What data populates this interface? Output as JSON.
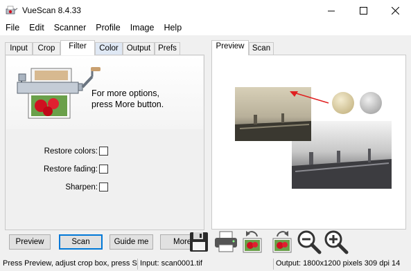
{
  "window": {
    "title": "VueScan 8.4.33"
  },
  "menu": [
    "File",
    "Edit",
    "Scanner",
    "Profile",
    "Image",
    "Help"
  ],
  "left_tabs": [
    "Input",
    "Crop",
    "Filter",
    "Color",
    "Output",
    "Prefs"
  ],
  "active_left_tab": "Filter",
  "right_tabs": [
    "Preview",
    "Scan"
  ],
  "active_right_tab": "Preview",
  "filter": {
    "hint_line1": "For more options,",
    "hint_line2": "press More button.",
    "options": [
      {
        "label": "Restore colors:",
        "checked": false
      },
      {
        "label": "Restore fading:",
        "checked": false
      },
      {
        "label": "Sharpen:",
        "checked": false
      }
    ]
  },
  "buttons": {
    "preview": "Preview",
    "scan": "Scan",
    "guide": "Guide me",
    "more": "More"
  },
  "toolbar_icons": [
    "save-icon",
    "print-icon",
    "rotate-left-icon",
    "rotate-right-icon",
    "zoom-out-icon",
    "zoom-in-icon"
  ],
  "status": {
    "message": "Press Preview, adjust crop box, press S",
    "input": "Input: scan0001.tif",
    "output": "Output: 1800x1200 pixels 309 dpi 14"
  },
  "colors": {
    "focus_accent": "#0078d7",
    "arrow": "#e02020",
    "photo_red": "#d01020"
  }
}
